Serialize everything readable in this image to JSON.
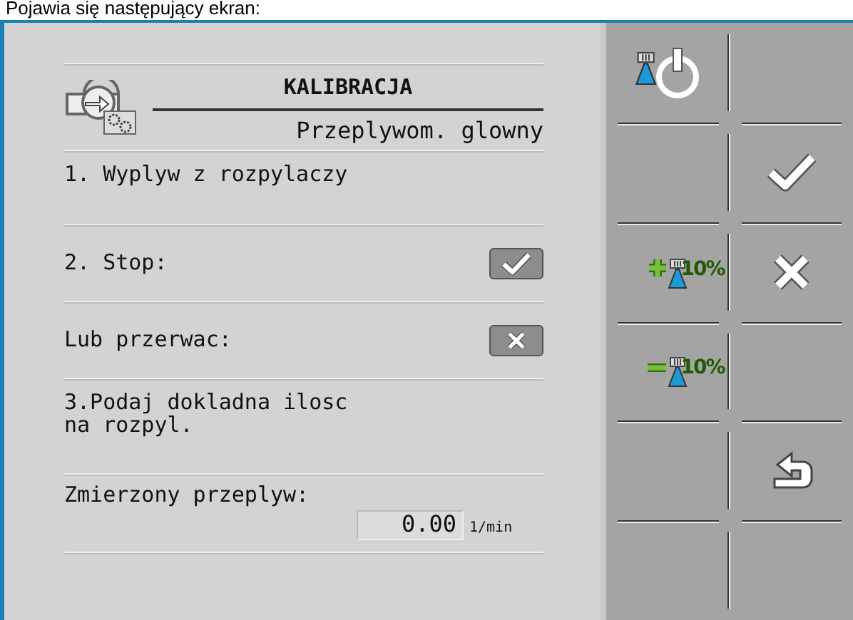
{
  "caption": "Pojawia się następujący ekran:",
  "header": {
    "title": "KALIBRACJA",
    "subtitle": "Przeplywom. glowny"
  },
  "steps": [
    {
      "kind": "text",
      "text": "1. Wyplyw z rozpylaczy"
    },
    {
      "kind": "confirm",
      "text": "2. Stop:"
    },
    {
      "kind": "cancel",
      "text": "Lub przerwac:"
    },
    {
      "kind": "text",
      "text": "3.Podaj dokladna ilosc\nna rozpyl."
    },
    {
      "kind": "input",
      "text": "Zmierzony przeplyw:",
      "value": "0.00",
      "unit": "1/min"
    }
  ],
  "softkeys": [
    [
      {
        "kind": "timer-power"
      },
      {
        "kind": "empty"
      }
    ],
    [
      {
        "kind": "empty"
      },
      {
        "kind": "confirm"
      }
    ],
    [
      {
        "kind": "plus",
        "label": "10%"
      },
      {
        "kind": "cancel"
      }
    ],
    [
      {
        "kind": "minus",
        "label": "10%"
      },
      {
        "kind": "empty"
      }
    ],
    [
      {
        "kind": "empty"
      },
      {
        "kind": "back"
      }
    ],
    [
      {
        "kind": "empty"
      },
      {
        "kind": "empty"
      }
    ]
  ]
}
